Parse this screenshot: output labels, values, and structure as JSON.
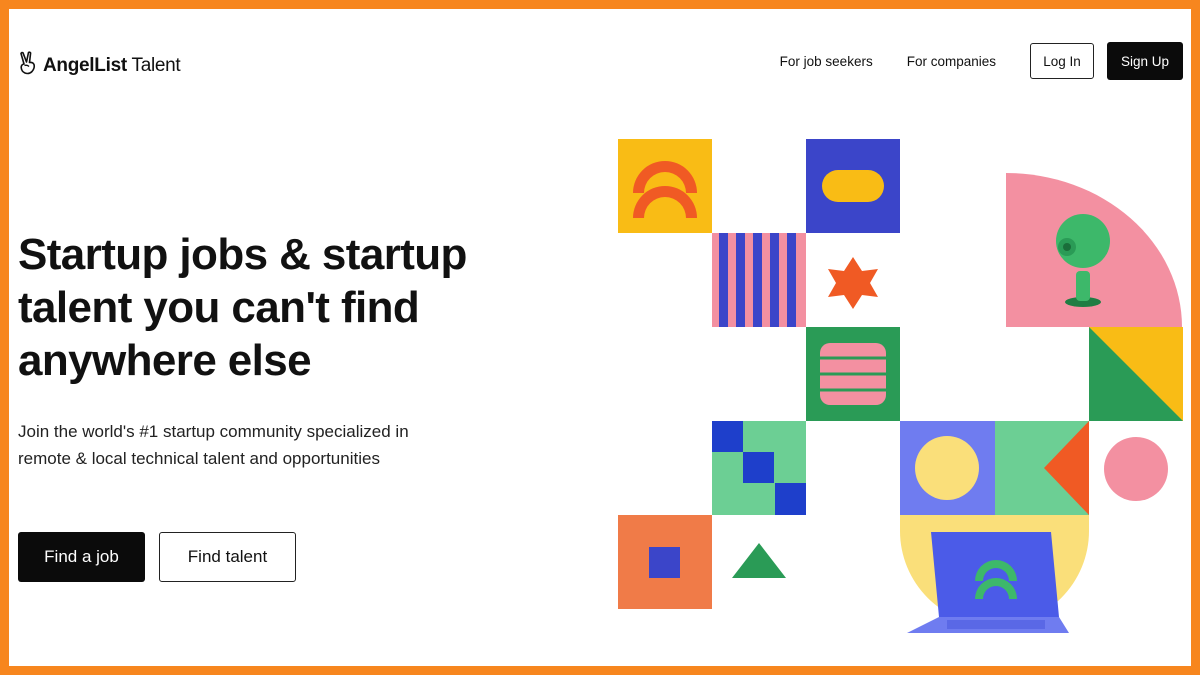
{
  "header": {
    "logo_brand": "AngelList",
    "logo_suffix": "Talent",
    "logo_icon": "victory-hand-icon",
    "nav": {
      "job_seekers": "For job seekers",
      "companies": "For companies",
      "login": "Log In",
      "signup": "Sign Up"
    }
  },
  "hero": {
    "headline": "Startup jobs & startup talent you can't find anywhere else",
    "subtext": "Join the world's #1 startup community specialized in remote & local technical talent and opportunities",
    "primary_cta": "Find a job",
    "secondary_cta": "Find talent"
  },
  "colors": {
    "frame": "#F7861E",
    "primary_button": "#0b0b0b",
    "yellow": "#F9BC15",
    "orange_red": "#F05A24",
    "blue": "#3B45C9",
    "pink": "#F390A1",
    "green": "#2A9B56",
    "mint": "#6CCF94",
    "orange": "#F07B48",
    "pale_yellow": "#FADF7A",
    "periwinkle": "#6F7CF0"
  }
}
